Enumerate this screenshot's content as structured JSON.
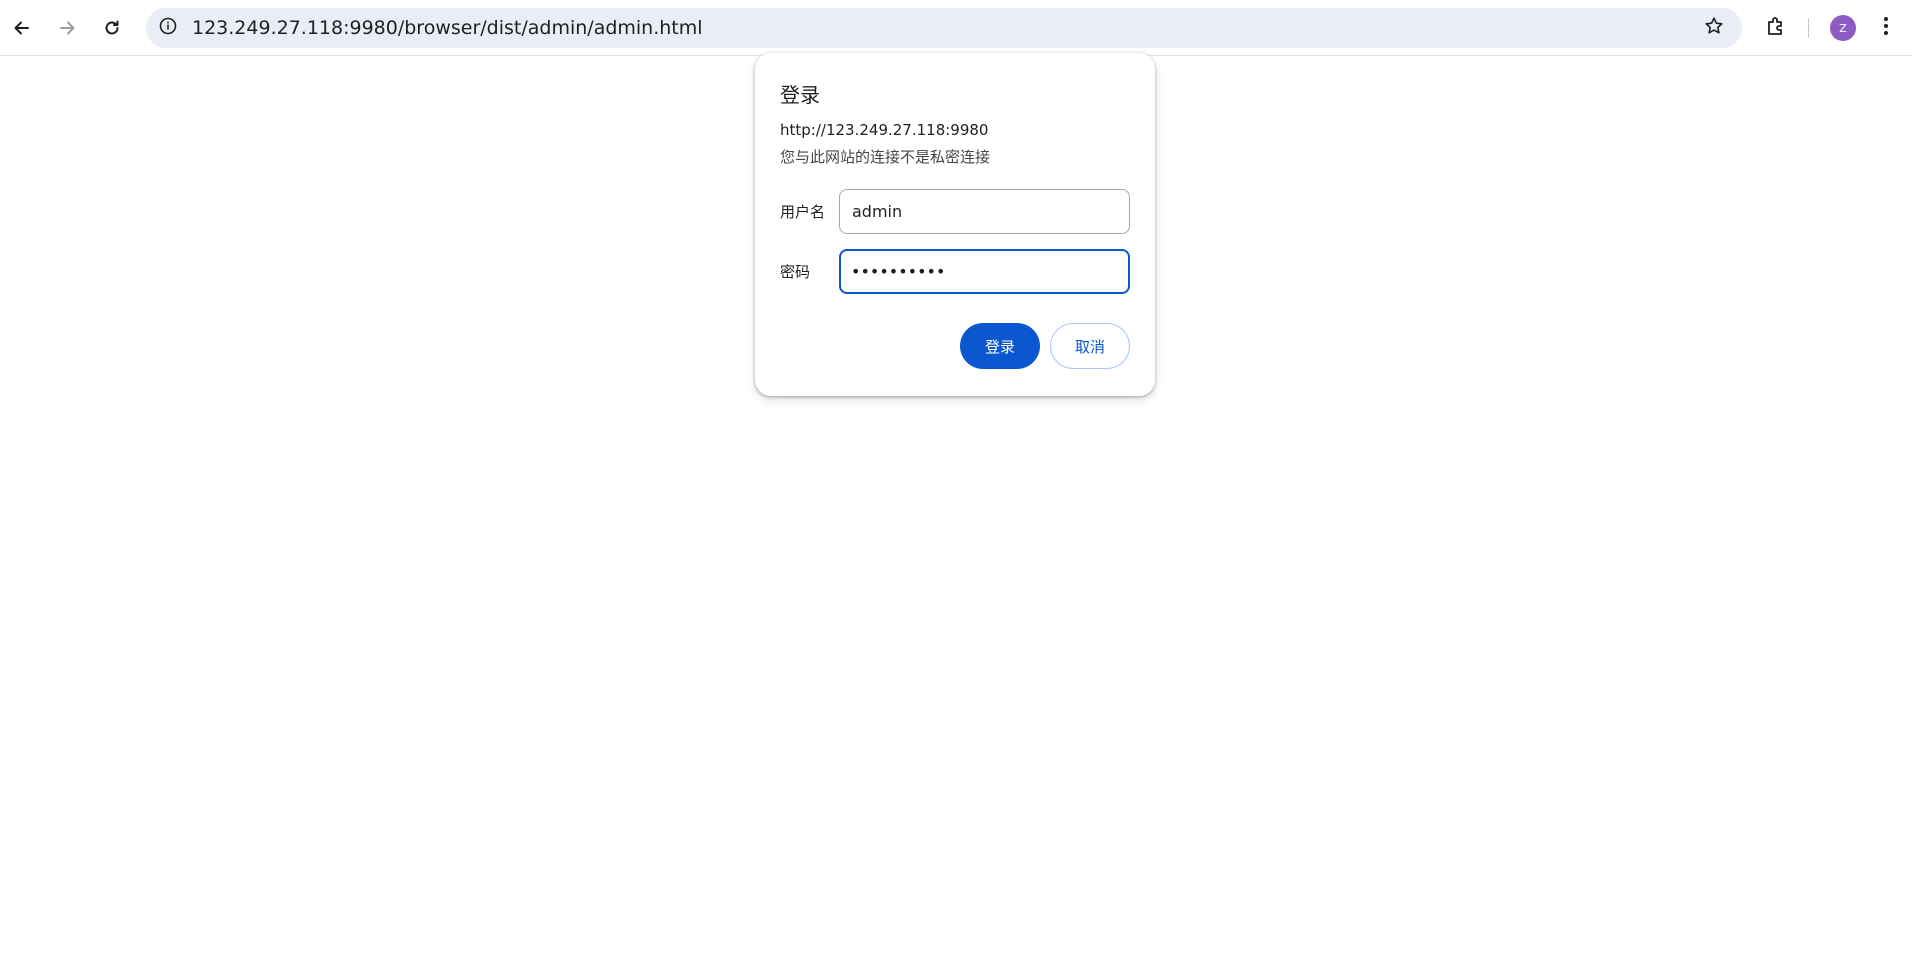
{
  "browser": {
    "address_bar": {
      "url": "123.249.27.118:9980/browser/dist/admin/admin.html"
    },
    "profile": {
      "initial": "Z",
      "color": "#8e5bc2"
    },
    "icons": {
      "back": "arrow-left-icon",
      "forward": "arrow-right-icon",
      "reload": "reload-icon",
      "site_info": "info-icon",
      "bookmark": "star-icon",
      "extensions": "puzzle-icon",
      "menu": "kebab-menu-icon"
    }
  },
  "dialog": {
    "title": "登录",
    "origin": "http://123.249.27.118:9980",
    "warning": "您与此网站的连接不是私密连接",
    "username_label": "用户名",
    "username_value": "admin",
    "password_label": "密码",
    "password_mask": "••••••••••",
    "login_button": "登录",
    "cancel_button": "取消",
    "accent_color": "#0b57d0"
  }
}
